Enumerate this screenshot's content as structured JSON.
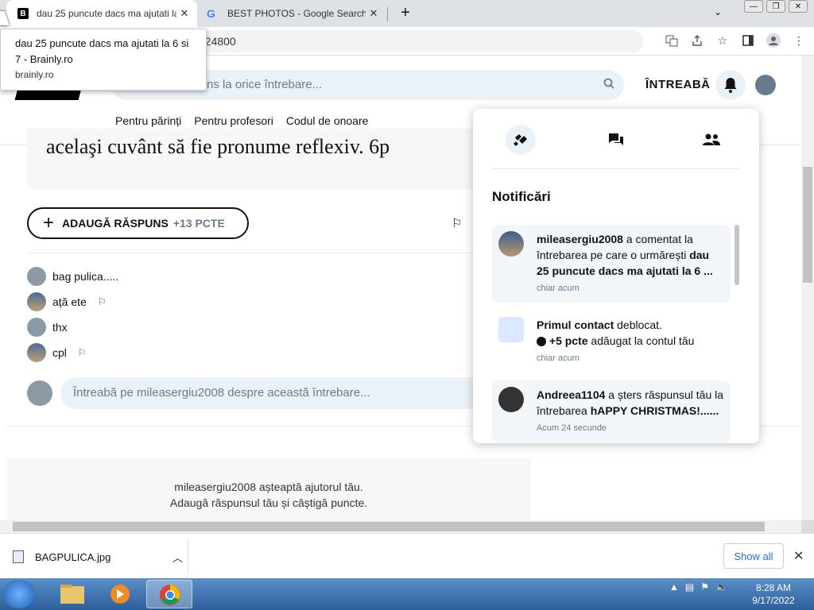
{
  "browser": {
    "tabs": [
      {
        "title": "dau 25 puncute dacs ma ajutati la 6 si 7 - Brainly.ro",
        "favicon": "B",
        "close": "✕"
      },
      {
        "title": "BEST PHOTOS - Google Search",
        "favicon": "G",
        "close": "✕"
      }
    ],
    "new_tab": "+",
    "address_fragment": "024800",
    "tooltip": {
      "title": "dau 25 puncute dacs ma ajutati la 6 si 7 - Brainly.ro",
      "url": "brainly.ro"
    }
  },
  "site": {
    "search_placeholder": "Găsește răspunsuri la orice întrebare...",
    "search_visible": "ns la orice întrebare...",
    "ask_label": "ÎNTREABĂ",
    "subnav": [
      "Pentru părinți",
      "Pentru profesori",
      "Codul de onoare"
    ],
    "question_text": "acelaşi cuvânt să fie pronume reflexiv. 6p",
    "add_answer_label": "ADAUGĂ RĂSPUNS",
    "add_answer_points": "+13 PCTE",
    "comments": [
      {
        "text": "bag pulica.....",
        "flag": false
      },
      {
        "text": "ață ete",
        "flag": true
      },
      {
        "text": "thx",
        "flag": false
      },
      {
        "text": "cpl",
        "flag": true
      }
    ],
    "comment_placeholder": "Întreabă pe mileasergiu2008 despre această întrebare...",
    "waiting_line1": "mileasergiu2008 așteaptă ajutorul tău.",
    "waiting_line2": "Adaugă răspunsul tău și câștigă puncte."
  },
  "notifications": {
    "heading": "Notificări",
    "items": [
      {
        "user": "mileasergiu2008",
        "text": " a comentat la întrebarea pe care o urmărești ",
        "target": "dau 25 puncute dacs ma ajutati la 6 ...",
        "time": "chiar acum",
        "unread": true
      },
      {
        "user": "Primul contact",
        "text": " deblocat.",
        "points": "+5 pcte",
        "points_suffix": " adăugat la contul tău",
        "time": "chiar acum",
        "unread": false
      },
      {
        "user": "Andreea1104",
        "text": " a șters răspunsul tău la întrebarea ",
        "target": "hAPPY CHRISTMAS!......",
        "time": "Acum 24 secunde",
        "unread": true
      }
    ]
  },
  "downloads": {
    "file": "BAGPULICA.jpg",
    "show_all": "Show all"
  },
  "taskbar": {
    "time": "8:28 AM",
    "date": "9/17/2022"
  },
  "colors": {
    "accent_bg": "#ebf2f7",
    "muted_text": "#687b8c"
  }
}
